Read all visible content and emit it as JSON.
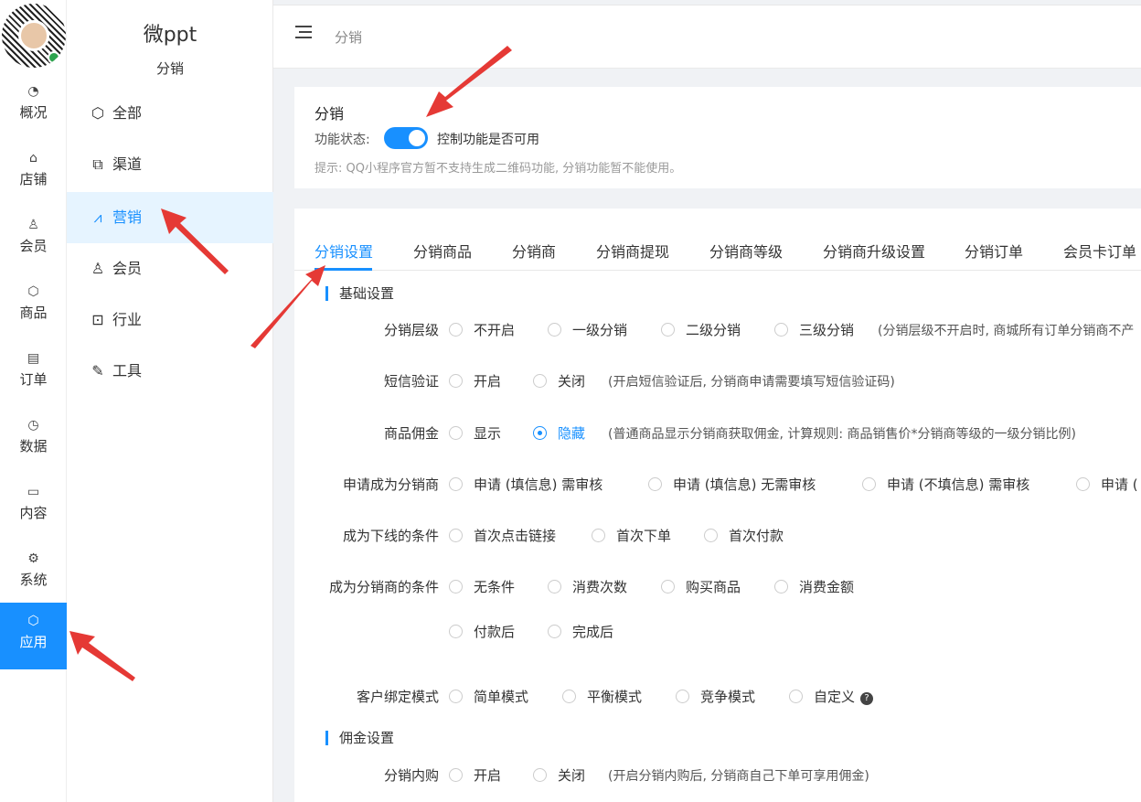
{
  "rail": {
    "items": [
      {
        "label": "概况",
        "icon": "dashboard-icon"
      },
      {
        "label": "店铺",
        "icon": "store-icon"
      },
      {
        "label": "会员",
        "icon": "user-icon"
      },
      {
        "label": "商品",
        "icon": "cube-icon"
      },
      {
        "label": "订单",
        "icon": "clipboard-icon"
      },
      {
        "label": "数据",
        "icon": "pie-chart-icon"
      },
      {
        "label": "内容",
        "icon": "folder-icon"
      },
      {
        "label": "系统",
        "icon": "gear-icon"
      },
      {
        "label": "应用",
        "icon": "cube-icon"
      }
    ],
    "active_index": 8
  },
  "sidebar": {
    "brand": "微ppt",
    "subtitle": "分销",
    "items": [
      {
        "label": "全部",
        "icon": "cube-icon"
      },
      {
        "label": "渠道",
        "icon": "share-nodes-icon"
      },
      {
        "label": "营销",
        "icon": "line-chart-icon"
      },
      {
        "label": "会员",
        "icon": "user-icon"
      },
      {
        "label": "行业",
        "icon": "briefcase-icon"
      },
      {
        "label": "工具",
        "icon": "wrench-icon"
      }
    ],
    "active_index": 2
  },
  "header": {
    "breadcrumb": "分销"
  },
  "status_card": {
    "title": "分销",
    "status_label": "功能状态:",
    "toggle_on": true,
    "toggle_desc": "控制功能是否可用",
    "tip": "提示: QQ小程序官方暂不支持生成二维码功能, 分销功能暂不能使用。"
  },
  "tabs": [
    "分销设置",
    "分销商品",
    "分销商",
    "分销商提现",
    "分销商等级",
    "分销商升级设置",
    "分销订单",
    "会员卡订单"
  ],
  "active_tab": 0,
  "sections": {
    "basic": "基础设置",
    "commission": "佣金设置"
  },
  "form": {
    "level": {
      "label": "分销层级",
      "options": [
        "不开启",
        "一级分销",
        "二级分销",
        "三级分销"
      ],
      "hint": "(分销层级不开启时, 商城所有订单分销商不产"
    },
    "sms": {
      "label": "短信验证",
      "options": [
        "开启",
        "关闭"
      ],
      "hint": "(开启短信验证后, 分销商申请需要填写短信验证码)"
    },
    "commission_display": {
      "label": "商品佣金",
      "options": [
        "显示",
        "隐藏"
      ],
      "selected": 1,
      "hint": "(普通商品显示分销商获取佣金, 计算规则: 商品销售价*分销商等级的一级分销比例)"
    },
    "apply": {
      "label": "申请成为分销商",
      "options": [
        "申请 (填信息) 需审核",
        "申请 (填信息) 无需审核",
        "申请 (不填信息) 需审核",
        "申请 ("
      ]
    },
    "downline": {
      "label": "成为下线的条件",
      "options": [
        "首次点击链接",
        "首次下单",
        "首次付款"
      ]
    },
    "become": {
      "label": "成为分销商的条件",
      "options": [
        "无条件",
        "消费次数",
        "购买商品",
        "消费金额"
      ],
      "options_row2": [
        "付款后",
        "完成后"
      ]
    },
    "binding": {
      "label": "客户绑定模式",
      "options": [
        "简单模式",
        "平衡模式",
        "竞争模式",
        "自定义"
      ],
      "help": "?"
    },
    "self_buy": {
      "label": "分销内购",
      "options": [
        "开启",
        "关闭"
      ],
      "hint": "(开启分销内购后, 分销商自己下单可享用佣金)"
    }
  },
  "colors": {
    "accent": "#1890ff",
    "arrow": "#e53935"
  }
}
